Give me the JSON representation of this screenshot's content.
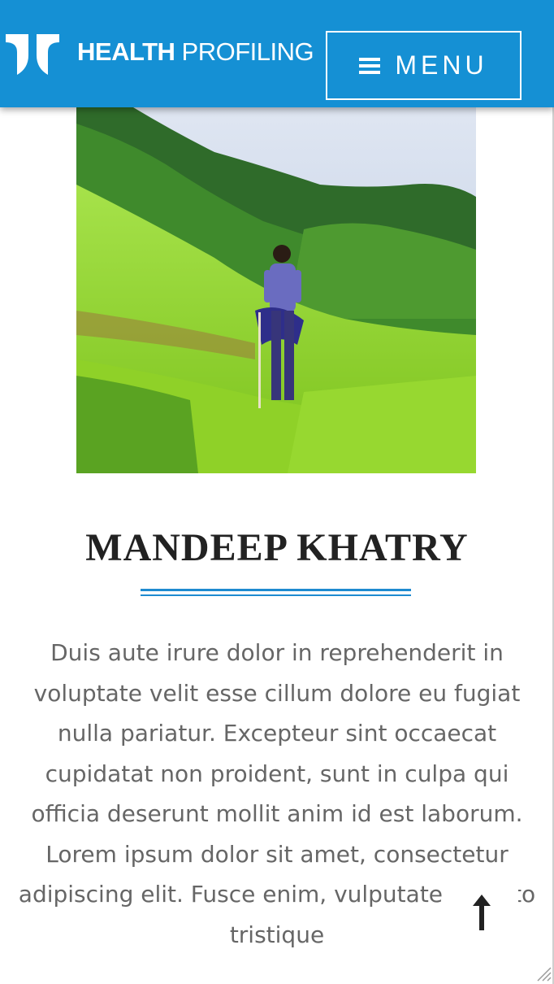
{
  "header": {
    "brand_bold": "HEALTH",
    "brand_light": "PROFILING",
    "menu_label": "MENU",
    "logo_icon": "logo-mark-icon",
    "menu_icon": "hamburger-icon"
  },
  "profile": {
    "name": "MANDEEP KHATRY",
    "bio": "Duis aute irure dolor in reprehenderit in voluptate velit esse cillum dolore eu fugiat nulla pariatur. Excepteur sint occaecat cupidatat non proident, sunt in culpa qui officia deserunt mollit anim id est laborum. Lorem ipsum dolor sit amet, consectetur adipiscing elit. Fusce enim, vulputate at justo tristique"
  },
  "back_to_top_icon": "arrow-up-icon",
  "colors": {
    "header_bg": "#1590d4",
    "accent": "#1f8bd0",
    "heading": "#222222",
    "body_text": "#666666"
  }
}
